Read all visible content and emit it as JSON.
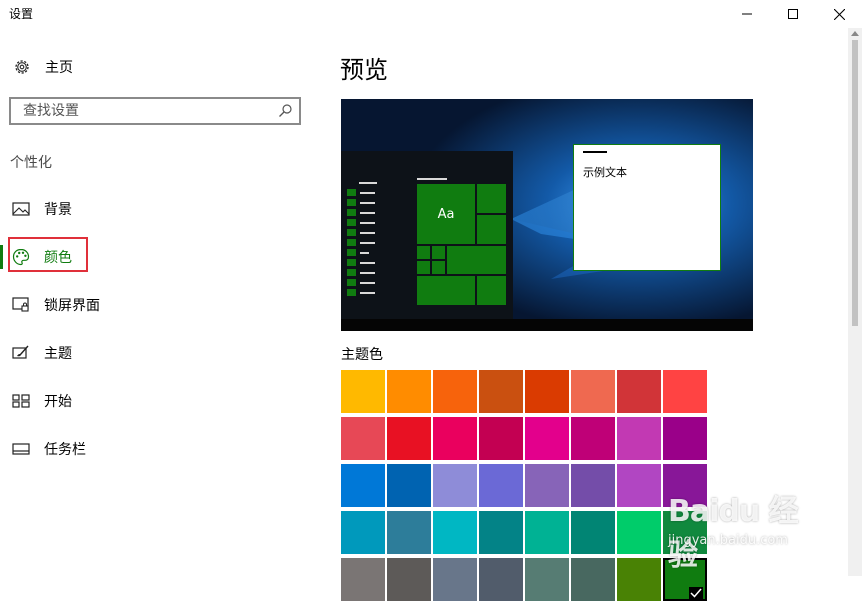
{
  "window": {
    "title": "设置",
    "minimize_icon": "minimize-icon",
    "maximize_icon": "maximize-icon",
    "close_icon": "close-icon"
  },
  "sidebar": {
    "home_label": "主页",
    "home_icon": "gear-icon",
    "search_placeholder": "查找设置",
    "search_icon": "search-icon",
    "section_label": "个性化",
    "items": [
      {
        "label": "背景",
        "icon": "picture-icon"
      },
      {
        "label": "颜色",
        "icon": "palette-icon",
        "active": true
      },
      {
        "label": "锁屏界面",
        "icon": "lock-screen-icon"
      },
      {
        "label": "主题",
        "icon": "theme-brush-icon"
      },
      {
        "label": "开始",
        "icon": "start-tiles-icon"
      },
      {
        "label": "任务栏",
        "icon": "taskbar-icon"
      }
    ]
  },
  "main": {
    "title": "预览",
    "preview": {
      "sample_text": "示例文本",
      "tile_text": "Aa"
    },
    "accent_title": "主题色",
    "accent_color": "#107c10",
    "swatches": [
      [
        "#ffb900",
        "#ff8c00",
        "#f7630c",
        "#ca5010",
        "#da3b01",
        "#ef6950",
        "#d13438",
        "#ff4343"
      ],
      [
        "#e74856",
        "#e81123",
        "#ea005e",
        "#c30052",
        "#e3008c",
        "#bf0077",
        "#c239b3",
        "#9a0089"
      ],
      [
        "#0078d7",
        "#0063b1",
        "#8e8cd8",
        "#6b69d6",
        "#8764b8",
        "#744da9",
        "#b146c2",
        "#881798"
      ],
      [
        "#0099bc",
        "#2d7d9a",
        "#00b7c3",
        "#038387",
        "#00b294",
        "#018574",
        "#00cc6a",
        "#10893e"
      ],
      [
        "#7a7574",
        "#5d5a58",
        "#68768a",
        "#515c6b",
        "#567c73",
        "#486860",
        "#498205",
        "#107c10"
      ]
    ],
    "selected_swatch": "#107c10"
  },
  "watermark": {
    "brand": "Baidu 经验",
    "url": "jingyan.baidu.com"
  }
}
